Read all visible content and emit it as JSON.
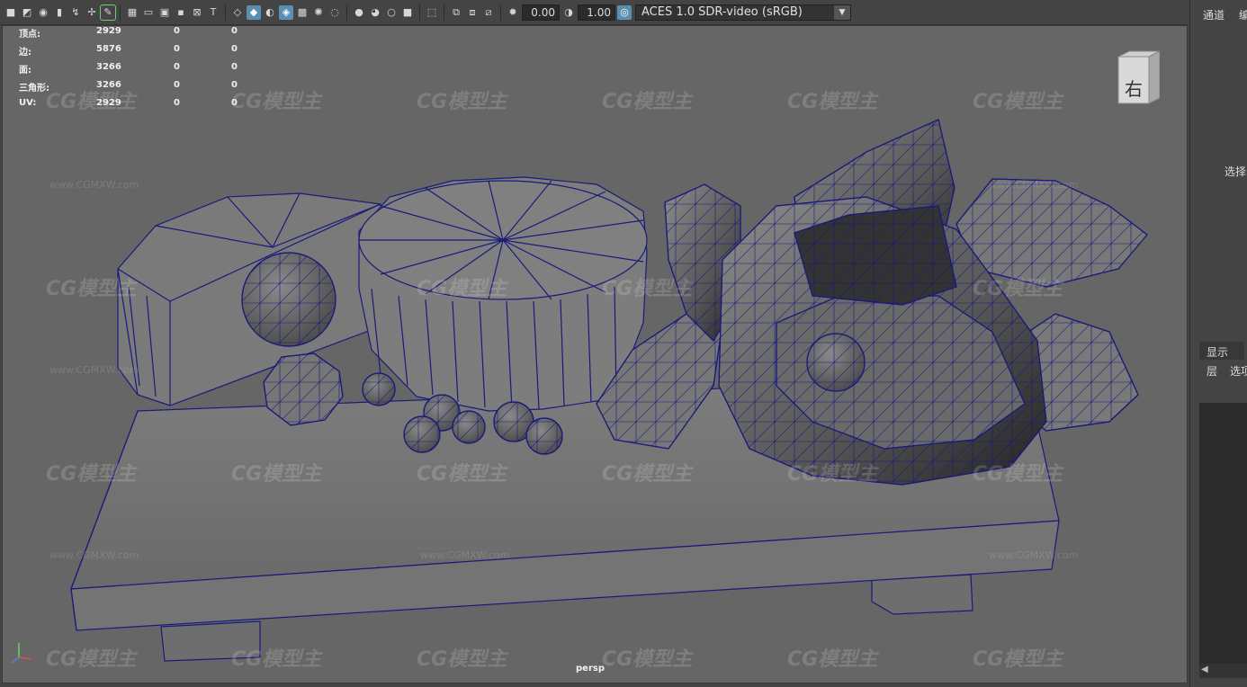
{
  "toolbar": {
    "exposure_value": "0.00",
    "gamma_value": "1.00",
    "colorspace": "ACES 1.0 SDR-video (sRGB)",
    "icons": [
      "camera-icon",
      "camera-attr-icon",
      "bookmark-icon",
      "image-plane-icon",
      "grid-icon",
      "film-gate-icon",
      "resolution-gate-icon",
      "gate-mask-icon",
      "field-chart-icon",
      "safe-action-icon",
      "safe-title-icon",
      "wireframe-icon",
      "smooth-shade-icon",
      "wireframe-on-shaded-icon",
      "textured-icon",
      "lights-icon",
      "shadows-icon",
      "ambient-occlusion-icon",
      "motion-blur-icon",
      "anti-alias-icon",
      "isolate-select-icon",
      "xray-icon",
      "xray-joints-icon",
      "xray-components-icon",
      "exposure-icon",
      "gamma-icon",
      "color-management-icon"
    ]
  },
  "hud": {
    "rows": [
      {
        "label": "顶点:",
        "value": "2929",
        "a": "0",
        "b": "0"
      },
      {
        "label": "边:",
        "value": "5876",
        "a": "0",
        "b": "0"
      },
      {
        "label": "面:",
        "value": "3266",
        "a": "0",
        "b": "0"
      },
      {
        "label": "三角形:",
        "value": "3266",
        "a": "0",
        "b": "0"
      },
      {
        "label": "UV:",
        "value": "2929",
        "a": "0",
        "b": "0"
      }
    ]
  },
  "viewport": {
    "camera": "persp",
    "viewcube_face": "右",
    "watermark": "CG模型主",
    "watermark_url": "www.CGMXW.com"
  },
  "right_panel": {
    "tab1": "通道",
    "tab2": "编",
    "select_label": "选择",
    "display_tab": "显示",
    "layer_label": "层",
    "options_label": "选项"
  },
  "colors": {
    "wire": "#1a1a7a",
    "viewport_bg": "#666666",
    "ui_bg": "#444444",
    "active_icon": "#5a8fb0"
  }
}
